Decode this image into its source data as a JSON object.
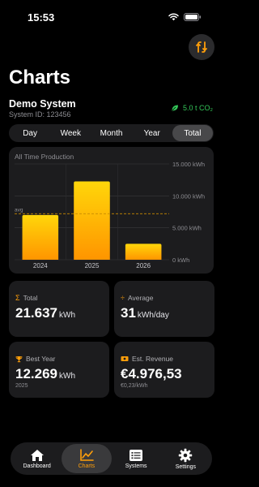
{
  "status_bar": {
    "time": "15:53"
  },
  "header": {
    "title": "Charts"
  },
  "system": {
    "name": "Demo System",
    "id_label": "System ID: 123456",
    "co2": "5.0 t CO₂"
  },
  "periods": [
    {
      "label": "Day",
      "active": false
    },
    {
      "label": "Week",
      "active": false
    },
    {
      "label": "Month",
      "active": false
    },
    {
      "label": "Year",
      "active": false
    },
    {
      "label": "Total",
      "active": true
    }
  ],
  "chart_data": {
    "type": "bar",
    "title": "All Time Production",
    "categories": [
      "2024",
      "2025",
      "2026"
    ],
    "values": [
      7000,
      12269,
      2500
    ],
    "y_ticks": [
      "15.000 kWh",
      "10.000 kWh",
      "5.000 kWh",
      "0 kWh"
    ],
    "y_tick_values": [
      15000,
      10000,
      5000,
      0
    ],
    "ylim": [
      0,
      15000
    ],
    "average_label": "avg",
    "average": 7200,
    "colors": {
      "bar_top": "#ffd60a",
      "bar_bottom": "#ff9500",
      "avg_line": "#c88a00"
    }
  },
  "stats": {
    "total": {
      "label": "Total",
      "value": "21.637",
      "unit": "kWh"
    },
    "average": {
      "label": "Average",
      "value": "31",
      "unit": "kWh/day"
    },
    "best_year": {
      "label": "Best Year",
      "value": "12.269",
      "unit": "kWh",
      "sub": "2025"
    },
    "revenue": {
      "label": "Est. Revenue",
      "value": "€4.976,53",
      "sub": "€0,23/kWh"
    }
  },
  "tabs": [
    {
      "label": "Dashboard",
      "icon": "house-icon",
      "active": false
    },
    {
      "label": "Charts",
      "icon": "chart-line-icon",
      "active": true
    },
    {
      "label": "Systems",
      "icon": "list-icon",
      "active": false
    },
    {
      "label": "Settings",
      "icon": "gear-icon",
      "active": false
    }
  ],
  "accent": "#ff9f0a"
}
